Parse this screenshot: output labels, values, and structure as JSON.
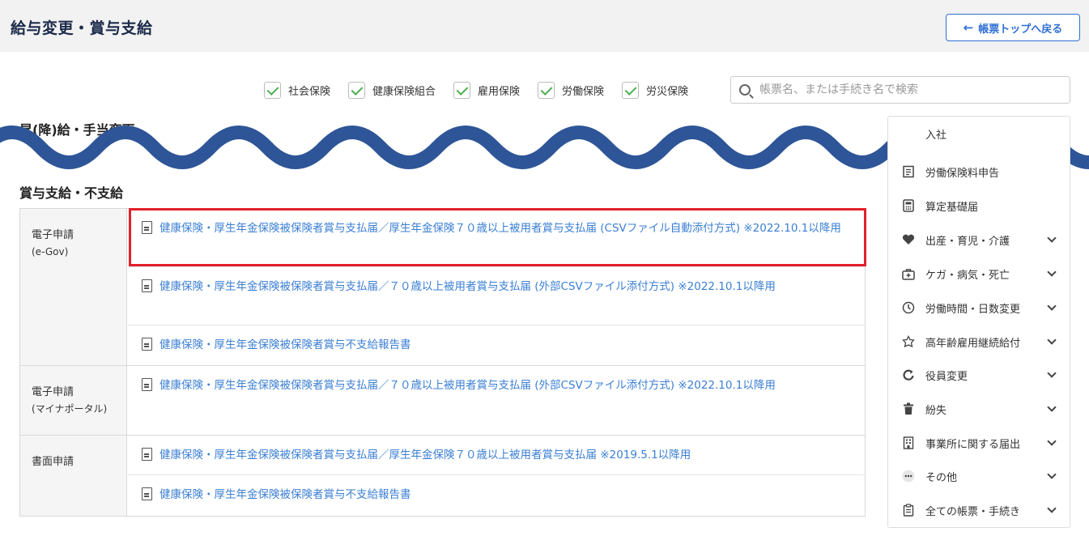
{
  "header": {
    "title": "給与変更・賞与支給",
    "back_arrow": "←",
    "back_label": "帳票トップへ戻る"
  },
  "filters": [
    {
      "label": "社会保険",
      "checked": true
    },
    {
      "label": "健康保険組合",
      "checked": true
    },
    {
      "label": "雇用保険",
      "checked": true
    },
    {
      "label": "労働保険",
      "checked": true
    },
    {
      "label": "労災保険",
      "checked": true
    }
  ],
  "search": {
    "placeholder": "帳票名、または手続き名で検索"
  },
  "sections": {
    "raise": "昇(降)給・手当変更",
    "bonus": "賞与支給・不支給"
  },
  "bonus_table": {
    "groups": [
      {
        "label": "電子申請",
        "sublabel": "(e-Gov)",
        "rows": [
          "健康保険・厚生年金保険被保険者賞与支払届／厚生年金保険７０歳以上被用者賞与支払届 (CSVファイル自動添付方式) ※2022.10.1以降用",
          "健康保険・厚生年金保険被保険者賞与支払届／７０歳以上被用者賞与支払届 (外部CSVファイル添付方式) ※2022.10.1以降用",
          "健康保険・厚生年金保険被保険者賞与不支給報告書"
        ]
      },
      {
        "label": "電子申請",
        "sublabel": "(マイナポータル)",
        "rows": [
          "健康保険・厚生年金保険被保険者賞与支払届／７０歳以上被用者賞与支払届 (外部CSVファイル添付方式) ※2022.10.1以降用"
        ]
      },
      {
        "label": "書面申請",
        "sublabel": "",
        "rows": [
          "健康保険・厚生年金保険被保険者賞与支払届／厚生年金保険７０歳以上被用者賞与支払届 ※2019.5.1以降用",
          "健康保険・厚生年金保険被保険者賞与不支給報告書"
        ]
      }
    ]
  },
  "sidebar": {
    "items": [
      {
        "label": "入社",
        "icon": "person-icon",
        "expandable": false
      },
      {
        "label": "労働保険料申告",
        "icon": "document-icon",
        "expandable": false
      },
      {
        "label": "算定基礎届",
        "icon": "calculator-icon",
        "expandable": false
      },
      {
        "label": "出産・育児・介護",
        "icon": "heart-icon",
        "expandable": true
      },
      {
        "label": "ケガ・病気・死亡",
        "icon": "medical-bag-icon",
        "expandable": true
      },
      {
        "label": "労働時間・日数変更",
        "icon": "clock-icon",
        "expandable": true
      },
      {
        "label": "高年齢雇用継続給付",
        "icon": "leaf-icon",
        "expandable": true
      },
      {
        "label": "役員変更",
        "icon": "refresh-icon",
        "expandable": true
      },
      {
        "label": "紛失",
        "icon": "trash-icon",
        "expandable": true
      },
      {
        "label": "事業所に関する届出",
        "icon": "building-icon",
        "expandable": true
      },
      {
        "label": "その他",
        "icon": "more-icon",
        "expandable": true
      },
      {
        "label": "全ての帳票・手続き",
        "icon": "clipboard-icon",
        "expandable": true
      }
    ]
  },
  "colors": {
    "link": "#3b7fd4",
    "highlight": "#e3202a",
    "wave": "#2e5597",
    "checkbox": "#4caf50"
  }
}
